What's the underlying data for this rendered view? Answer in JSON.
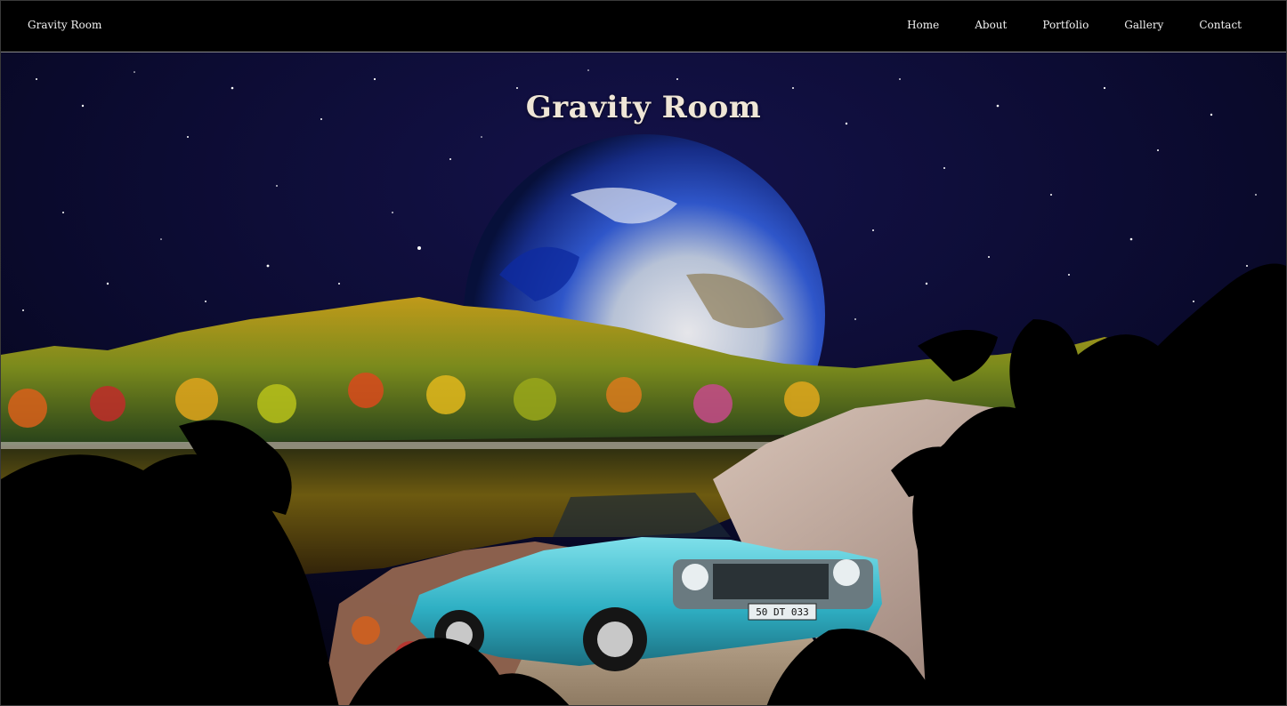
{
  "navbar": {
    "brand": "Gravity Room",
    "links": [
      "Home",
      "About",
      "Portfolio",
      "Gallery",
      "Contact"
    ]
  },
  "hero": {
    "title": "Gravity Room",
    "plate_text": "50 DT 033"
  },
  "colors": {
    "sky": "#07061f",
    "earth_blue": "#1b3fae",
    "car_body": "#35b5c6",
    "water": "#1f2a12"
  }
}
